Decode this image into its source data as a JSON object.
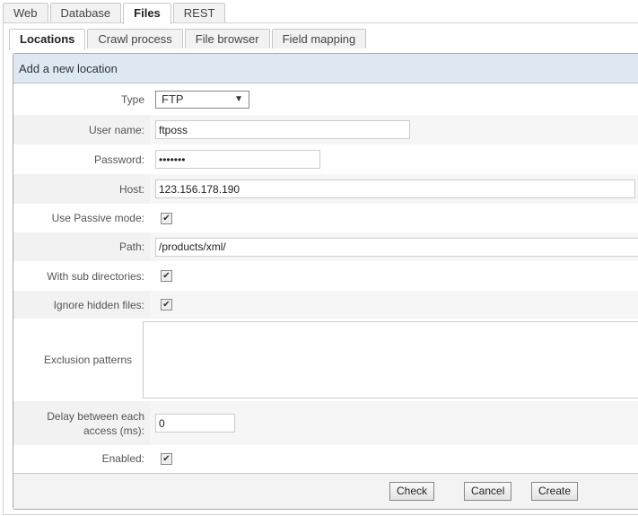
{
  "outer_tabs": [
    "Web",
    "Database",
    "Files",
    "REST"
  ],
  "outer_active": "Files",
  "inner_tabs": [
    "Locations",
    "Crawl process",
    "File browser",
    "Field mapping"
  ],
  "inner_active": "Locations",
  "panel_title": "Add a new location",
  "form": {
    "type_label": "Type",
    "type_value": "FTP",
    "user_label": "User name:",
    "user_value": "ftposs",
    "password_label": "Password:",
    "password_value": "•••••••",
    "host_label": "Host:",
    "host_value": "123.156.178.190",
    "passive_label": "Use Passive mode:",
    "passive_checked": true,
    "path_label": "Path:",
    "path_value": "/products/xml/",
    "subdirs_label": "With sub directories:",
    "subdirs_checked": true,
    "hidden_label": "Ignore hidden files:",
    "hidden_checked": true,
    "exclusion_label": "Exclusion patterns",
    "exclusion_value": "",
    "delay_label": "Delay between each access (ms):",
    "delay_value": "0",
    "enabled_label": "Enabled:",
    "enabled_checked": true
  },
  "buttons": {
    "check": "Check",
    "cancel": "Cancel",
    "create": "Create"
  },
  "colors": {
    "header_bg": "#dee8f3"
  }
}
